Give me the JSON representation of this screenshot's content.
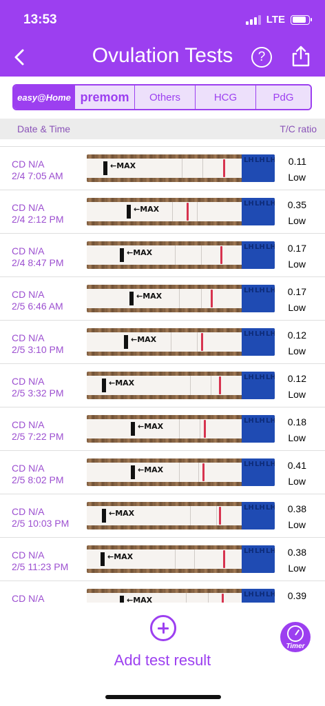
{
  "status_bar": {
    "time": "13:53",
    "network": "LTE",
    "battery_percent": 85,
    "signal_bars_active": 3
  },
  "header": {
    "title": "Ovulation Tests",
    "help_label": "?"
  },
  "tabs": [
    {
      "label": "easy@Home",
      "selected": true
    },
    {
      "label": "premom",
      "selected": false
    },
    {
      "label": "Others",
      "selected": false
    },
    {
      "label": "HCG",
      "selected": false
    },
    {
      "label": "PdG",
      "selected": false
    }
  ],
  "columns": {
    "left": "Date & Time",
    "right": "T/C ratio"
  },
  "tests": [
    {
      "cd": "CD N/A",
      "datetime": "2/4 7:05 AM",
      "ratio": "0.11",
      "level": "Low"
    },
    {
      "cd": "CD N/A",
      "datetime": "2/4 2:12 PM",
      "ratio": "0.35",
      "level": "Low"
    },
    {
      "cd": "CD N/A",
      "datetime": "2/4 8:47 PM",
      "ratio": "0.17",
      "level": "Low"
    },
    {
      "cd": "CD N/A",
      "datetime": "2/5 6:46 AM",
      "ratio": "0.17",
      "level": "Low"
    },
    {
      "cd": "CD N/A",
      "datetime": "2/5 3:10 PM",
      "ratio": "0.12",
      "level": "Low"
    },
    {
      "cd": "CD N/A",
      "datetime": "2/5 3:32 PM",
      "ratio": "0.12",
      "level": "Low"
    },
    {
      "cd": "CD N/A",
      "datetime": "2/5 7:22 PM",
      "ratio": "0.18",
      "level": "Low"
    },
    {
      "cd": "CD N/A",
      "datetime": "2/5 8:02 PM",
      "ratio": "0.41",
      "level": "Low"
    },
    {
      "cd": "CD N/A",
      "datetime": "2/5 10:03 PM",
      "ratio": "0.38",
      "level": "Low"
    },
    {
      "cd": "CD N/A",
      "datetime": "2/5 11:23 PM",
      "ratio": "0.38",
      "level": "Low"
    },
    {
      "cd": "CD N/A",
      "datetime": "",
      "ratio": "0.39",
      "level": ""
    }
  ],
  "strip_text": {
    "max": "MAX",
    "lh": "LH"
  },
  "footer": {
    "add_label": "Add test result",
    "timer_label": "Timer"
  },
  "colors": {
    "accent": "#9c3ff0",
    "tab_bg": "#ede0fb",
    "control_line": "#d7334f",
    "handle": "#1f4bb3"
  }
}
